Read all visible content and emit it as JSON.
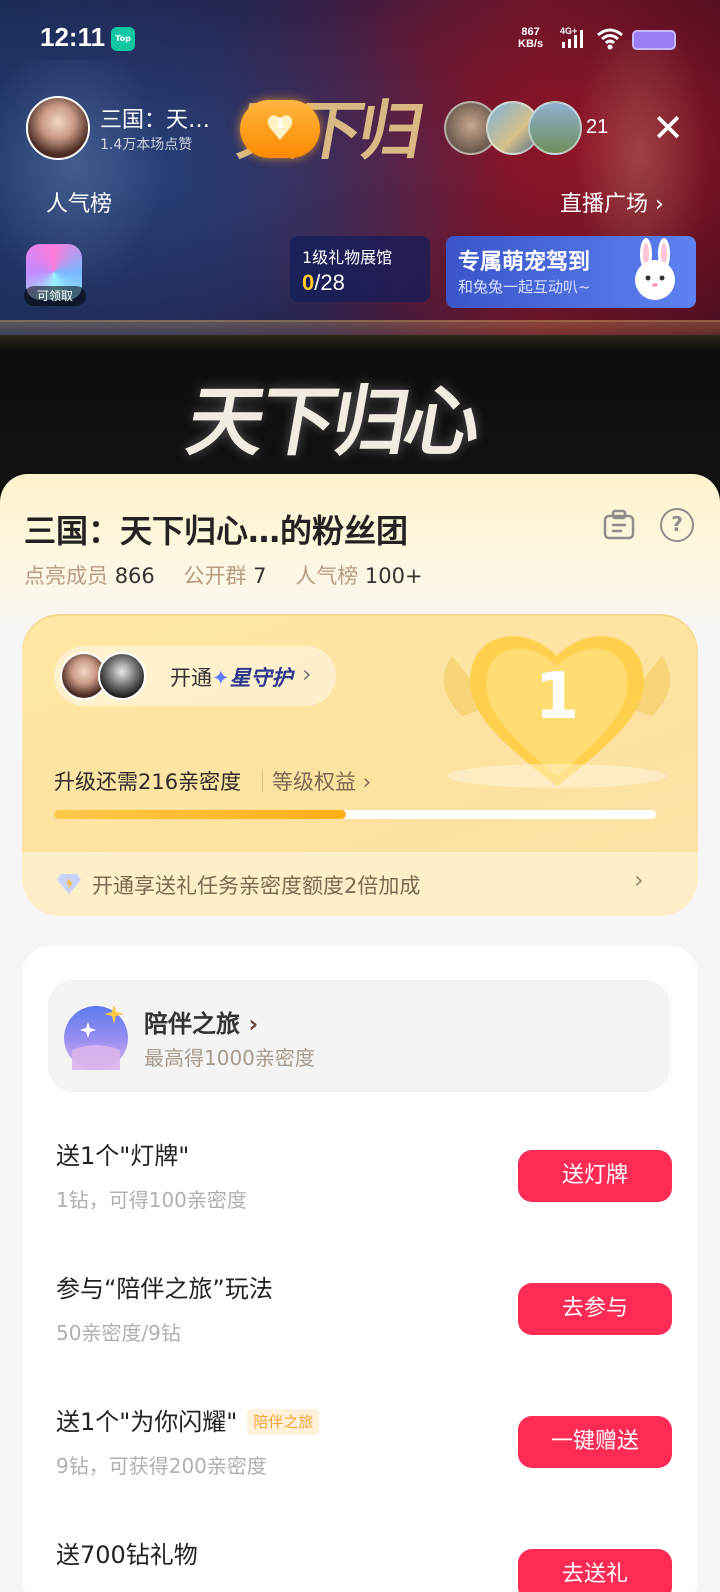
{
  "status_bar": {
    "time": "12:11",
    "top_badge": "Top",
    "net_speed_value": "867",
    "net_speed_unit": "KB/s",
    "network": "4G+"
  },
  "stream": {
    "anchor_name": "三国：天…",
    "anchor_likes": "1.4万本场点赞",
    "fan_level": "1",
    "viewer_count": "21",
    "rank_link": "人气榜",
    "plaza_link": "直播广场",
    "claim_label": "可领取",
    "gift_hall": {
      "title": "1级礼物展馆",
      "progress_current": "0",
      "progress_total": "/28"
    },
    "pet_banner": {
      "title": "专属萌宠驾到",
      "subtitle": "和兔兔一起互动叭~"
    }
  },
  "fan_club": {
    "title": "三国：天下归心…的粉丝团",
    "stats": [
      {
        "label": "点亮成员",
        "value": "866"
      },
      {
        "label": "公开群",
        "value": "7"
      },
      {
        "label": "人气榜",
        "value": "100+"
      }
    ],
    "level": {
      "current_level": "1",
      "guard_open_prefix": "开通",
      "guard_name": "星守护",
      "need_text": "升级还需216亲密度",
      "benefit_link": "等级权益",
      "progress_fraction": 0.485,
      "promo_text": "开通享送礼任务亲密度额度2倍加成"
    },
    "journey": {
      "title": "陪伴之旅",
      "subtitle": "最高得1000亲密度"
    },
    "tasks": [
      {
        "title": "送1个\"灯牌\"",
        "subtitle": "1钻，可得100亲密度",
        "button": "送灯牌",
        "tag": ""
      },
      {
        "title": "参与“陪伴之旅”玩法",
        "subtitle": "50亲密度/9钻",
        "button": "去参与",
        "tag": ""
      },
      {
        "title": "送1个\"为你闪耀\"",
        "subtitle": "9钻，可获得200亲密度",
        "button": "一键赠送",
        "tag": "陪伴之旅"
      },
      {
        "title": "送700钻礼物",
        "subtitle": "",
        "button": "去送礼",
        "tag": ""
      }
    ]
  },
  "colors": {
    "accent_red": "#ff2b55",
    "progress_orange": "#ffae17",
    "card_yellow": "#ffe7a6"
  },
  "icons": [
    "signal-icon",
    "wifi-icon",
    "battery-icon",
    "close-icon",
    "chevron-right-icon",
    "task-list-icon",
    "help-icon",
    "diamond-icon",
    "journey-icon",
    "heart-badge-icon",
    "bunny-icon"
  ]
}
